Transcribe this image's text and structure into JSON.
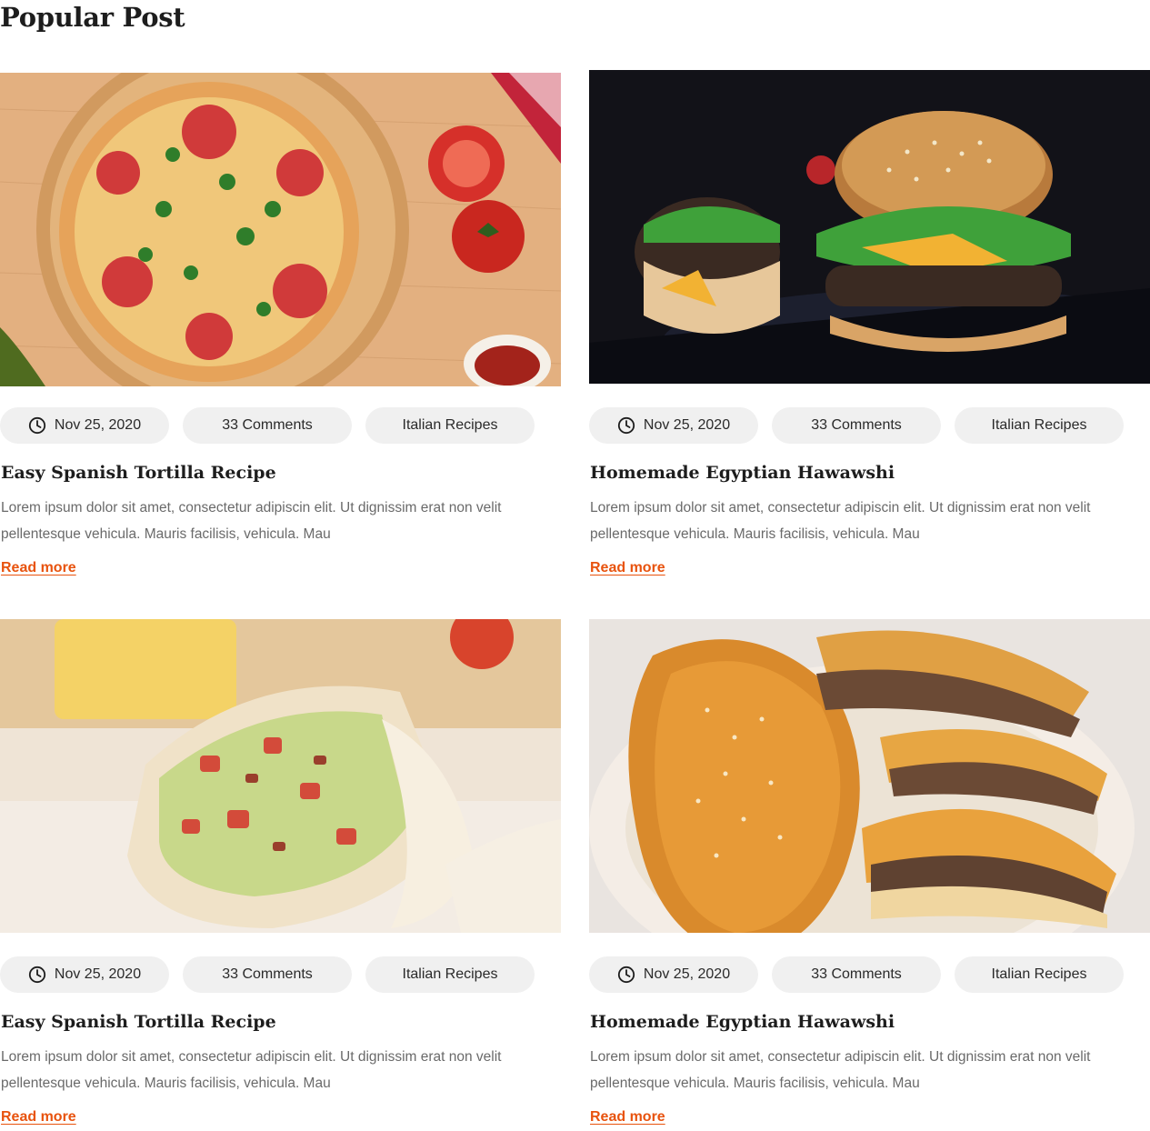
{
  "section": {
    "title": "Popular Post"
  },
  "posts": [
    {
      "image": "pizza-photo",
      "date": "Nov 25, 2020",
      "comments": "33 Comments",
      "category": "Italian Recipes",
      "title": "Easy Spanish Tortilla Recipe",
      "excerpt": "Lorem ipsum dolor sit amet, consectetur adipiscin elit. Ut dignissim erat non velit pellentesque vehicula. Mauris facilisis, vehicula. Mau",
      "read_more": "Read more"
    },
    {
      "image": "burger-photo",
      "date": "Nov 25, 2020",
      "comments": "33 Comments",
      "category": "Italian Recipes",
      "title": "Homemade Egyptian Hawawshi",
      "excerpt": "Lorem ipsum dolor sit amet, consectetur adipiscin elit. Ut dignissim erat non velit pellentesque vehicula. Mauris facilisis, vehicula. Mau",
      "read_more": "Read more"
    },
    {
      "image": "wrap-photo",
      "date": "Nov 25, 2020",
      "comments": "33 Comments",
      "category": "Italian Recipes",
      "title": "Easy Spanish Tortilla Recipe",
      "excerpt": "Lorem ipsum dolor sit amet, consectetur adipiscin elit. Ut dignissim erat non velit pellentesque vehicula. Mauris facilisis, vehicula. Mau",
      "read_more": "Read more"
    },
    {
      "image": "pastry-photo",
      "date": "Nov 25, 2020",
      "comments": "33 Comments",
      "category": "Italian Recipes",
      "title": "Homemade Egyptian Hawawshi",
      "excerpt": "Lorem ipsum dolor sit amet, consectetur adipiscin elit. Ut dignissim erat non velit pellentesque vehicula. Mauris facilisis, vehicula. Mau",
      "read_more": "Read more"
    }
  ],
  "colors": {
    "accent": "#e8530e",
    "chip_bg": "#f0f0f0",
    "text_muted": "#6a6a6a",
    "heading": "#1d1d1d"
  }
}
